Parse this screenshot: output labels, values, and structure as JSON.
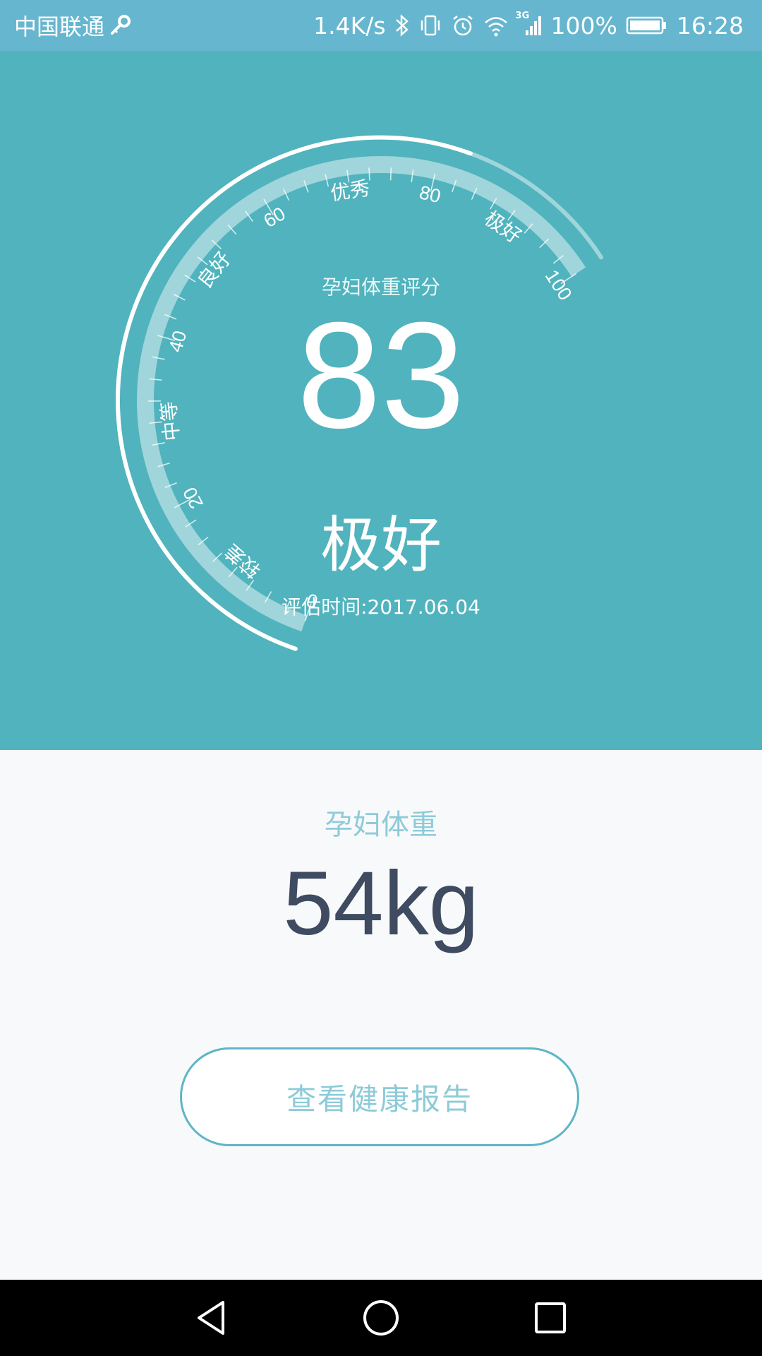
{
  "status_bar": {
    "carrier": "中国联通",
    "net_speed": "1.4K/s",
    "network_type": "3G",
    "battery": "100%",
    "time": "16:28",
    "icons": [
      "key-icon",
      "bluetooth-icon",
      "vibrate-icon",
      "alarm-icon",
      "wifi-icon",
      "signal-icon",
      "battery-icon"
    ]
  },
  "gauge": {
    "title": "孕妇体重评分",
    "score": "83",
    "score_numeric": 83,
    "min": 0,
    "max": 100,
    "number_ticks": [
      "0",
      "20",
      "40",
      "60",
      "80",
      "100"
    ],
    "zone_labels": [
      "较差",
      "中等",
      "良好",
      "优秀",
      "极好"
    ],
    "rating": "极好",
    "eval_time": "评估时间:2017.06.04"
  },
  "weight": {
    "title": "孕妇体重",
    "value": "54kg"
  },
  "actions": {
    "report_button": "查看健康报告"
  },
  "nav": {
    "back": "back-icon",
    "home": "home-icon",
    "recents": "recents-icon"
  },
  "colors": {
    "status_bar": "#67b6cf",
    "panel": "#50b3bd",
    "page": "#f8f9fa",
    "accent_text": "#8dcbd8",
    "weight_text": "#3e4b60",
    "button_border": "#5fb5c6"
  }
}
